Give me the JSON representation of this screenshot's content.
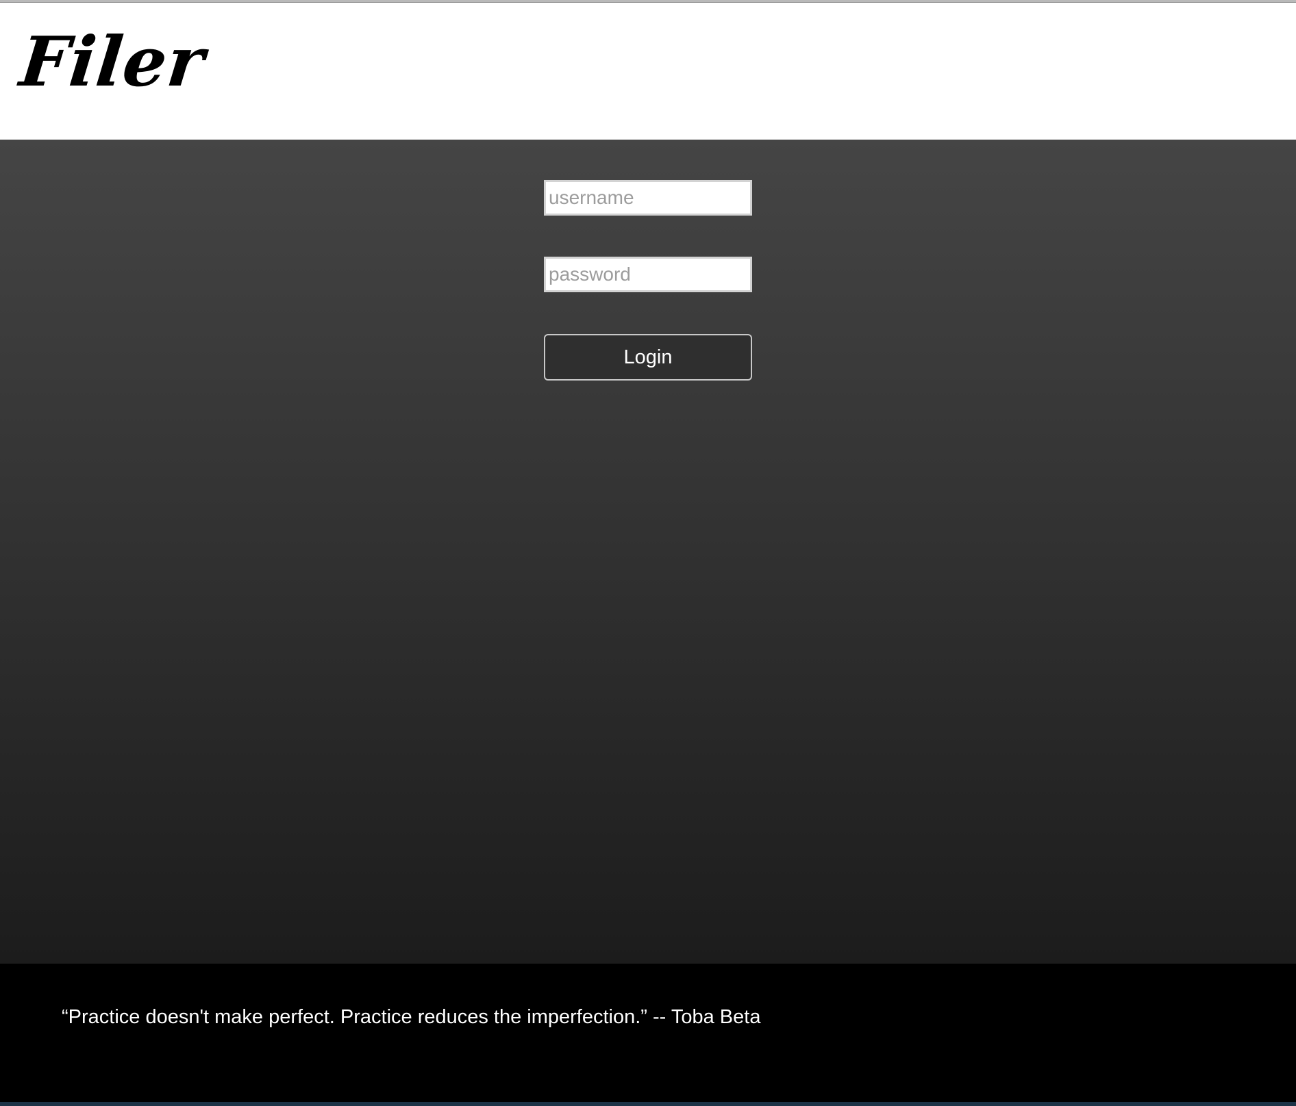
{
  "header": {
    "logo_text": "Filer"
  },
  "login_form": {
    "username": {
      "placeholder": "username",
      "value": ""
    },
    "password": {
      "placeholder": "password",
      "value": ""
    },
    "login_label": "Login"
  },
  "footer": {
    "quote": "“Practice doesn't make perfect. Practice reduces the imperfection.” -- Toba Beta"
  },
  "colors": {
    "header_background": "#ffffff",
    "main_gradient_top": "#454545",
    "main_gradient_bottom": "#1c1c1c",
    "footer_background": "#000000",
    "button_background": "#2f2f2f",
    "text_light": "#ffffff"
  }
}
